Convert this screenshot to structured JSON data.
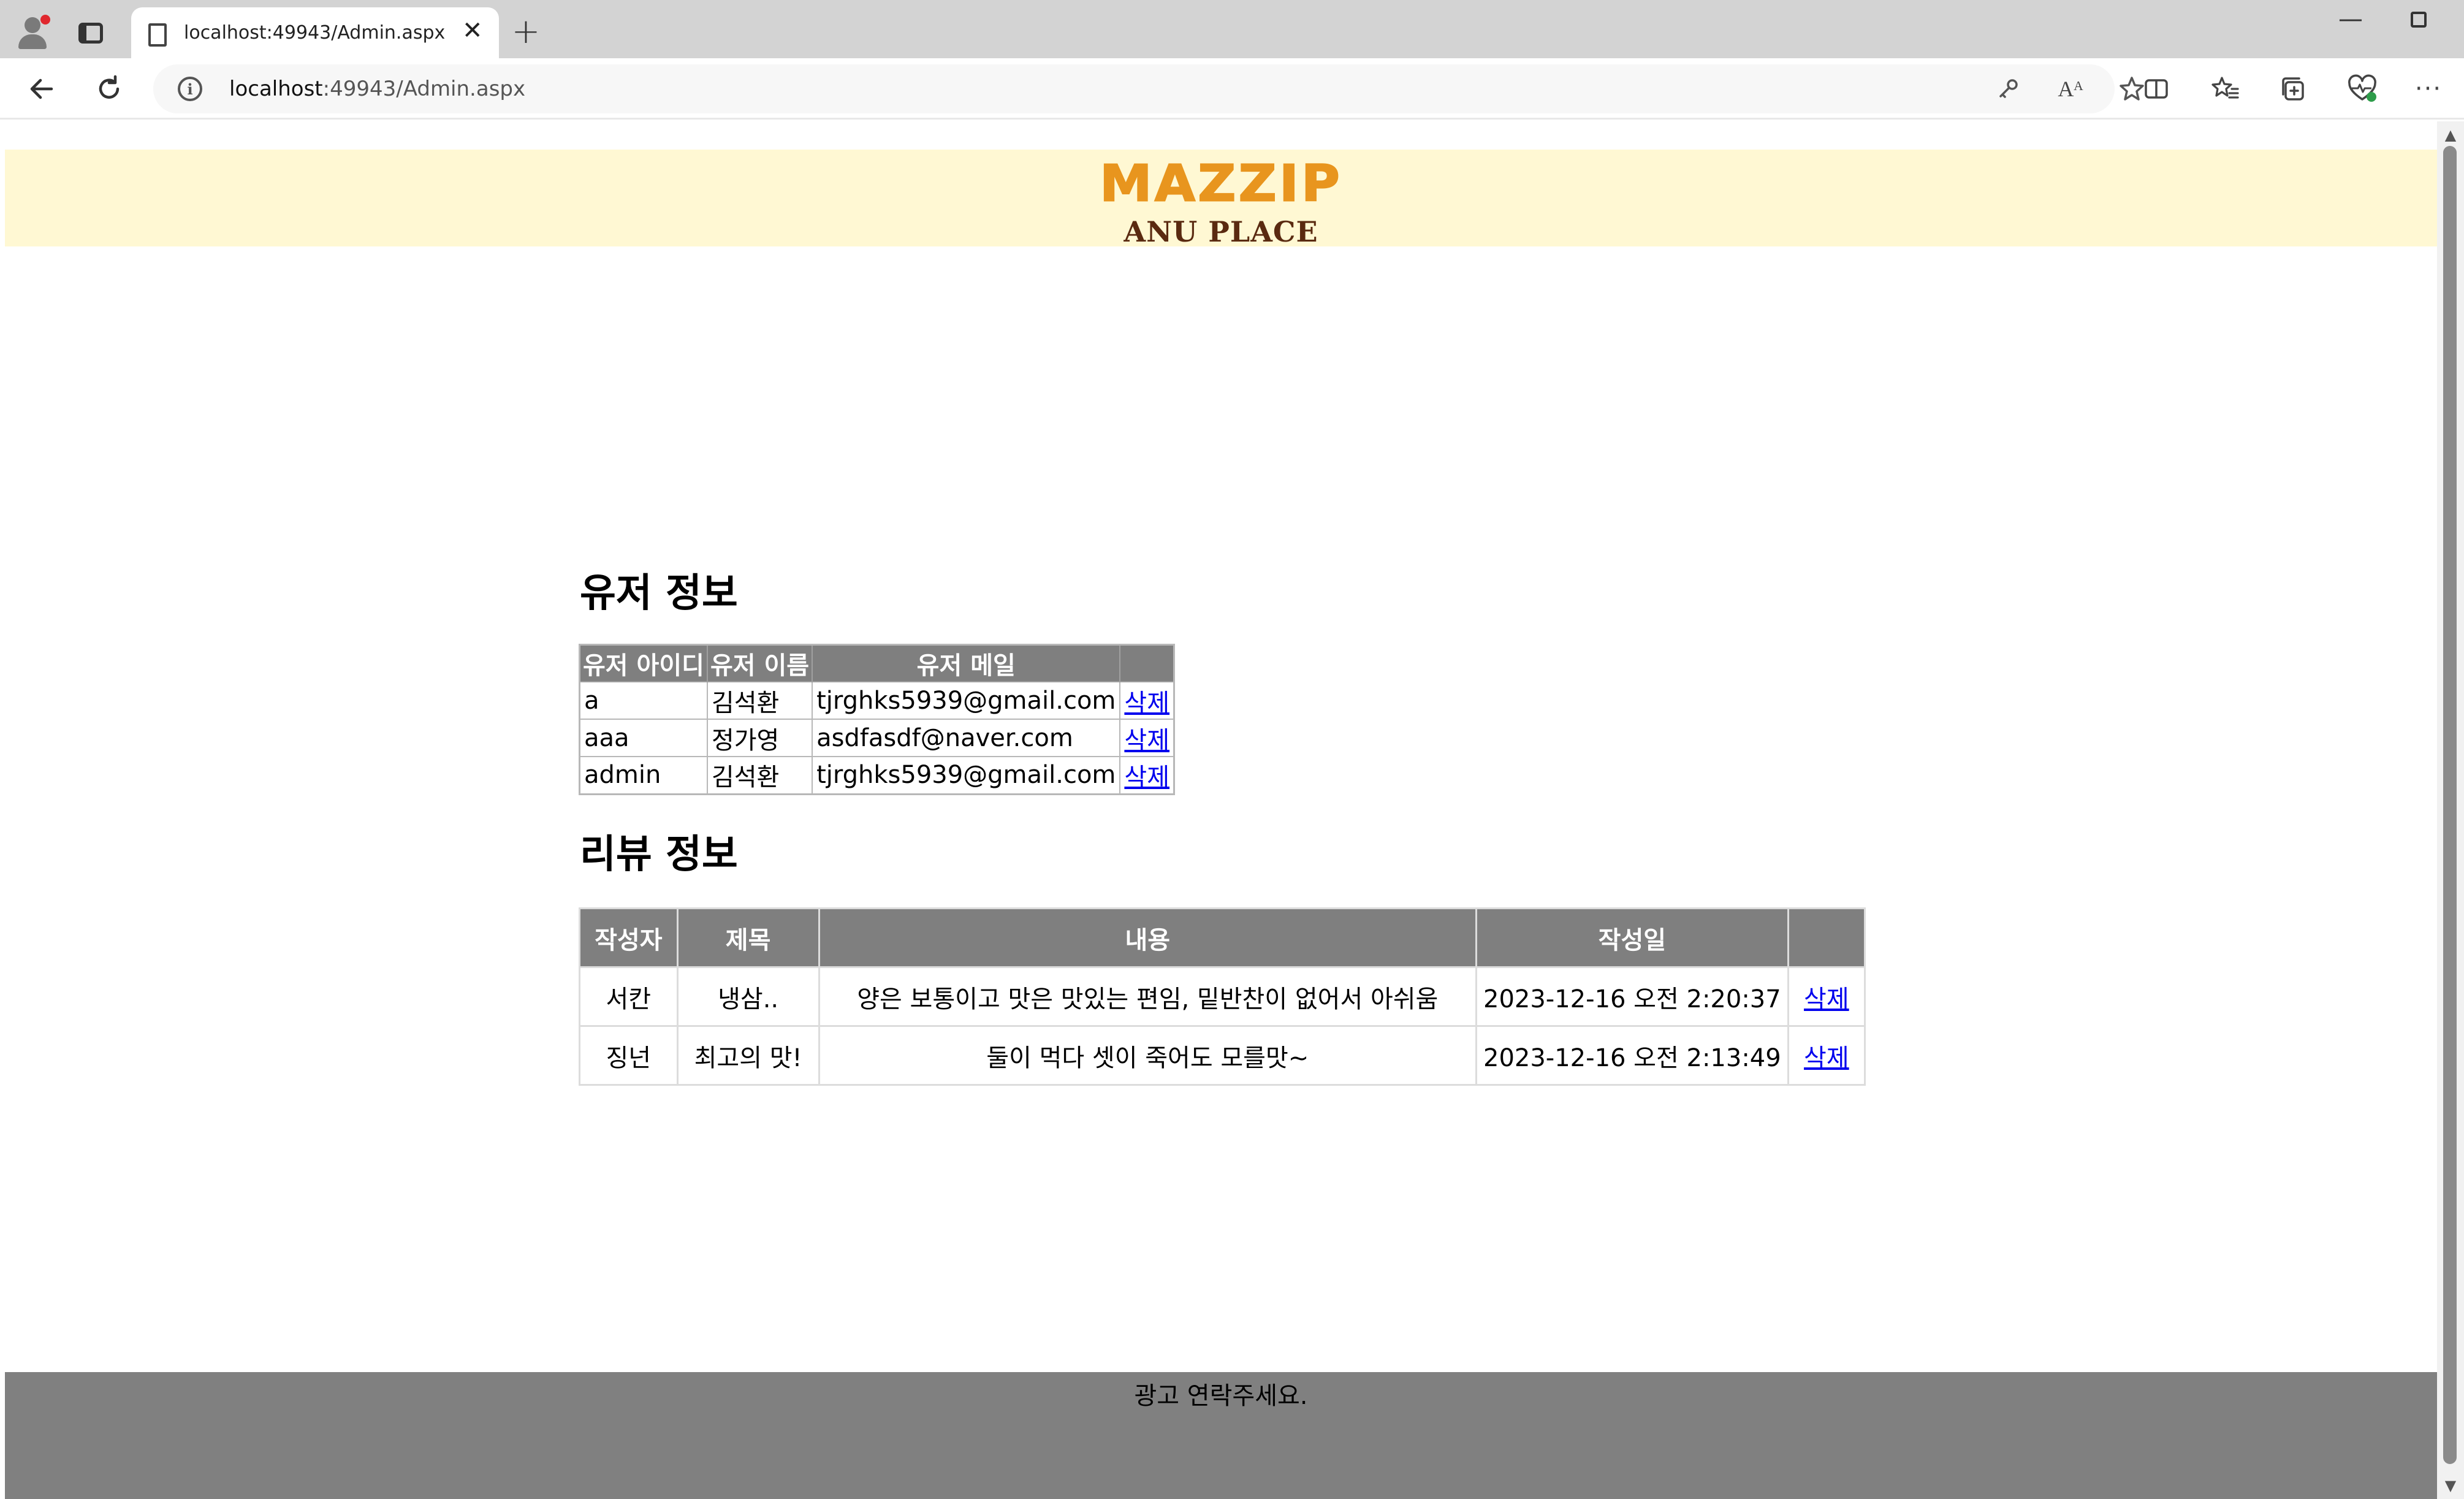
{
  "browser": {
    "tab_title": "localhost:49943/Admin.aspx",
    "tab_close": "✕",
    "new_tab": "+",
    "url_host": "localhost",
    "url_rest": ":49943/Admin.aspx",
    "minimize": "—"
  },
  "header": {
    "logo_main": "MAZZIP",
    "logo_sub": "ANU PLACE",
    "bg_color": "#fff8d3",
    "logo_color": "#e8951e"
  },
  "users": {
    "title": "유저 정보",
    "columns": [
      "유저 아이디",
      "유저 이름",
      "유저 메일"
    ],
    "rows": [
      {
        "id": "a",
        "name": "김석환",
        "email": "tjrghks5939@gmail.com",
        "action": "삭제"
      },
      {
        "id": "aaa",
        "name": "정가영",
        "email": "asdfasdf@naver.com",
        "action": "삭제"
      },
      {
        "id": "admin",
        "name": "김석환",
        "email": "tjrghks5939@gmail.com",
        "action": "삭제"
      }
    ]
  },
  "reviews": {
    "title": "리뷰 정보",
    "columns": [
      "작성자",
      "제목",
      "내용",
      "작성일",
      ""
    ],
    "rows": [
      {
        "author": "서칸",
        "subject": "냉삼..",
        "content": "양은 보통이고 맛은 맛있는 편임, 밑반찬이 없어서 아쉬움",
        "date": "2023-12-16 오전 2:20:37",
        "action": "삭제"
      },
      {
        "author": "징넌",
        "subject": "최고의 맛!",
        "content": "둘이 먹다 셋이 죽어도 모를맛~",
        "date": "2023-12-16 오전 2:13:49",
        "action": "삭제"
      }
    ]
  },
  "footer": {
    "text": "광고 연락주세요.",
    "bg_color": "#808080"
  }
}
